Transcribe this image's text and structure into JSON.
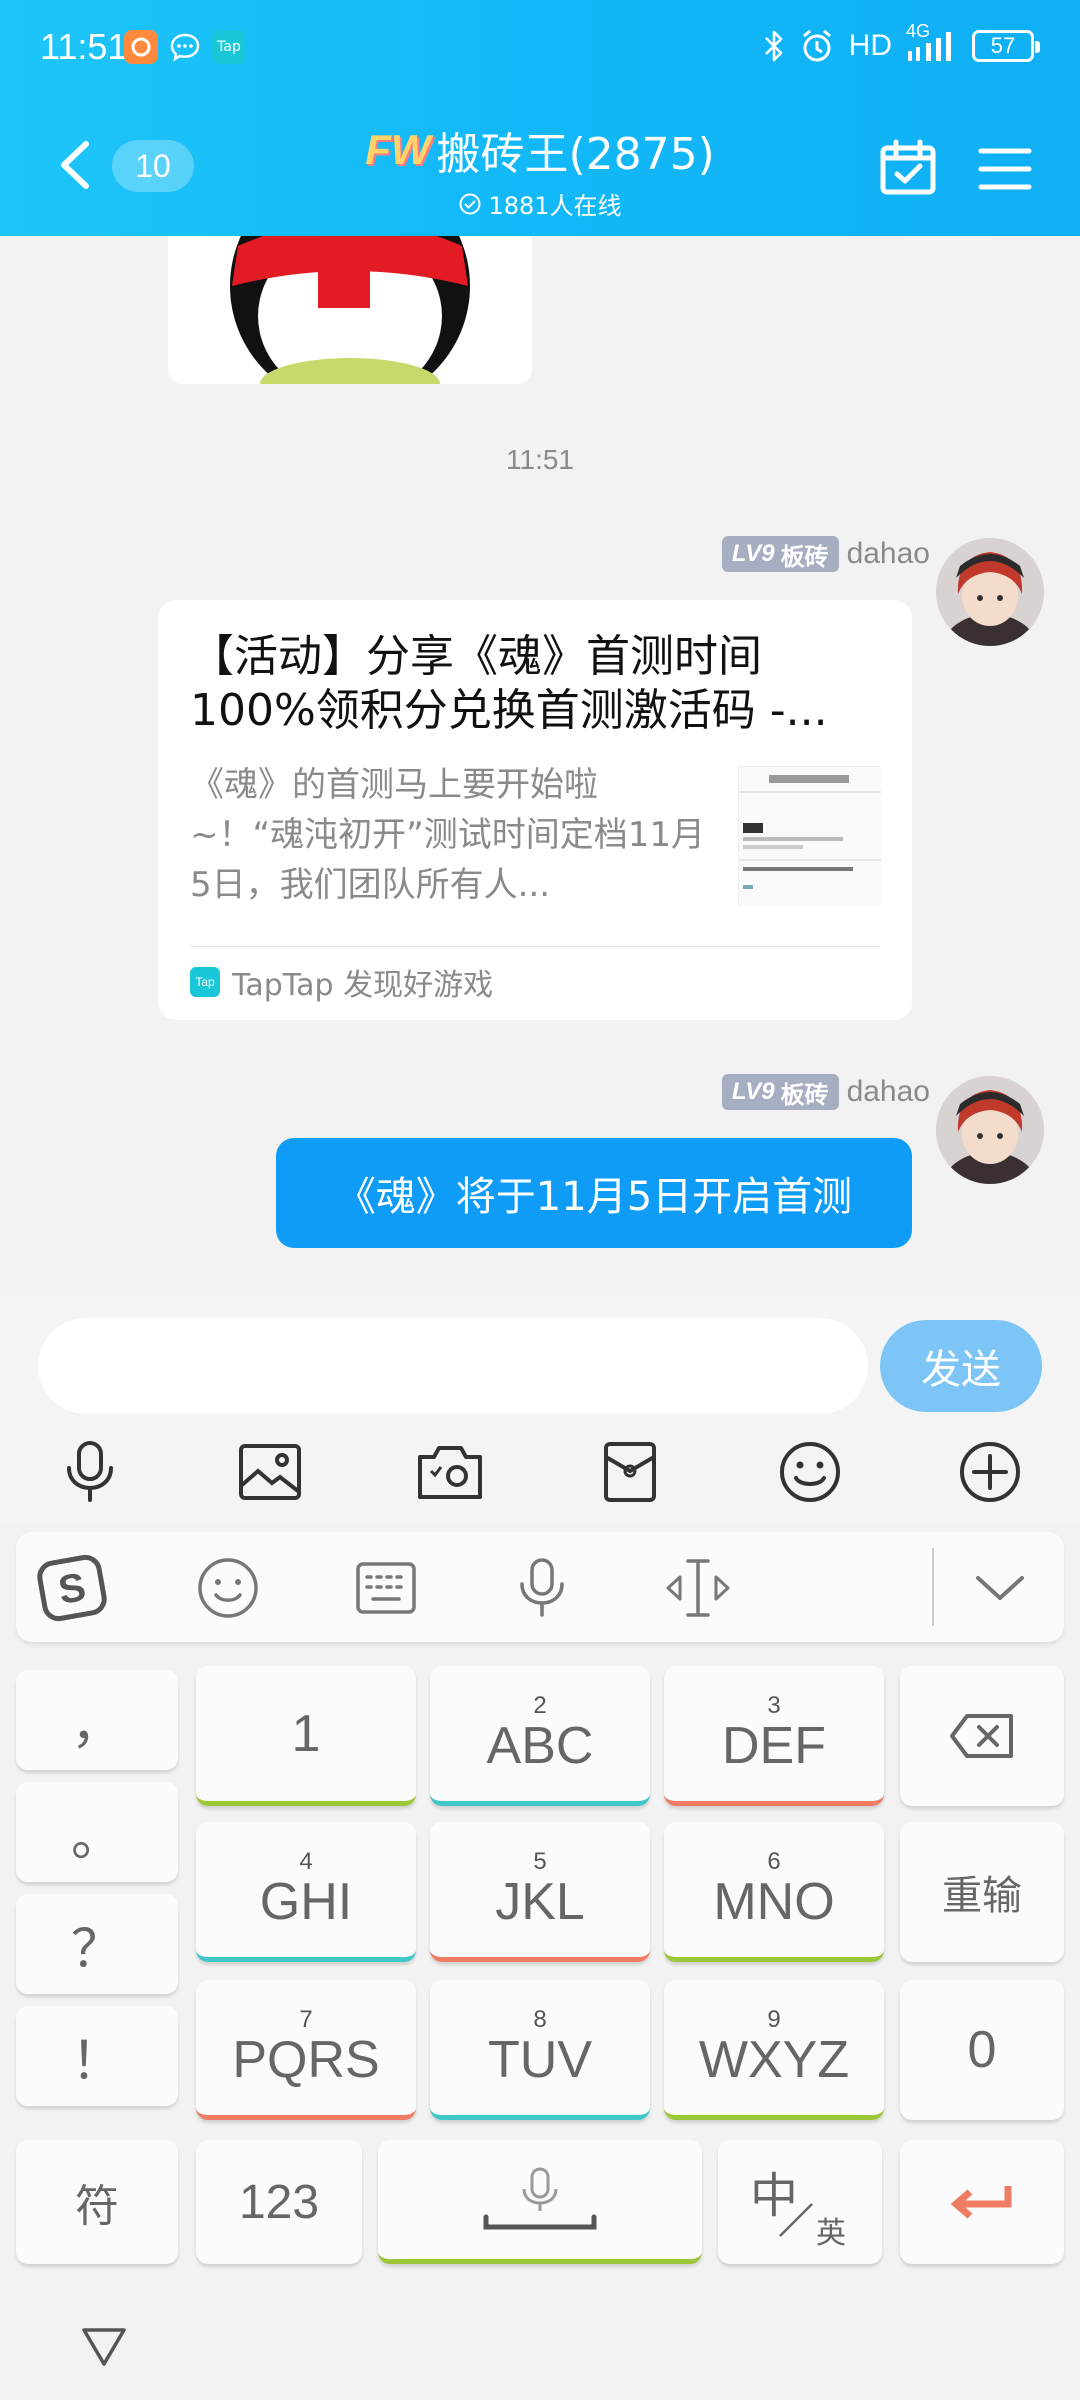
{
  "status_bar": {
    "time": "11:51",
    "left_icons": [
      "uc-browser-icon",
      "message-icon",
      "taptap-icon"
    ],
    "taptap_label": "Tap",
    "network": "HD",
    "network_type": "4G",
    "battery": "57"
  },
  "header": {
    "unread_count": "10",
    "logo_text": "FW",
    "group_name": "搬砖王(2875)",
    "online_text": "1881人在线"
  },
  "chat": {
    "timestamp": "11:51",
    "messages": [
      {
        "sender": {
          "level": "LV9",
          "title": "板砖",
          "name": "dahao"
        },
        "type": "link-card",
        "card": {
          "title": "【活动】分享《魂》首测时间100%领积分兑换首测激活码 -...",
          "description": "《魂》的首测马上要开始啦~！“魂沌初开”测试时间定档11月5日，我们团队所有人...",
          "source": "TapTap 发现好游戏",
          "source_icon_label": "Tap"
        }
      },
      {
        "sender": {
          "level": "LV9",
          "title": "板砖",
          "name": "dahao"
        },
        "type": "text",
        "text": "《魂》将于11月5日开启首测"
      }
    ]
  },
  "input_bar": {
    "placeholder": "",
    "send_label": "发送",
    "tools": [
      "microphone-icon",
      "image-icon",
      "camera-icon",
      "red-packet-icon",
      "emoji-icon",
      "plus-icon"
    ]
  },
  "keyboard": {
    "toolbar": [
      "sogou-logo-icon",
      "emoji-icon",
      "keyboard-icon",
      "microphone-icon",
      "cursor-move-icon",
      "chevron-down-icon"
    ],
    "punctuation": [
      "，",
      "。",
      "？",
      "！"
    ],
    "keys": [
      {
        "num": "",
        "letters": "1"
      },
      {
        "num": "2",
        "letters": "ABC"
      },
      {
        "num": "3",
        "letters": "DEF"
      },
      {
        "num": "4",
        "letters": "GHI"
      },
      {
        "num": "5",
        "letters": "JKL"
      },
      {
        "num": "6",
        "letters": "MNO"
      },
      {
        "num": "7",
        "letters": "PQRS"
      },
      {
        "num": "8",
        "letters": "TUV"
      },
      {
        "num": "9",
        "letters": "WXYZ"
      }
    ],
    "reenter_label": "重输",
    "zero_label": "0",
    "symbol_label": "符",
    "numeric_label": "123",
    "lang_main": "中",
    "lang_sub": "英",
    "accent_color": "#ef7d63"
  }
}
